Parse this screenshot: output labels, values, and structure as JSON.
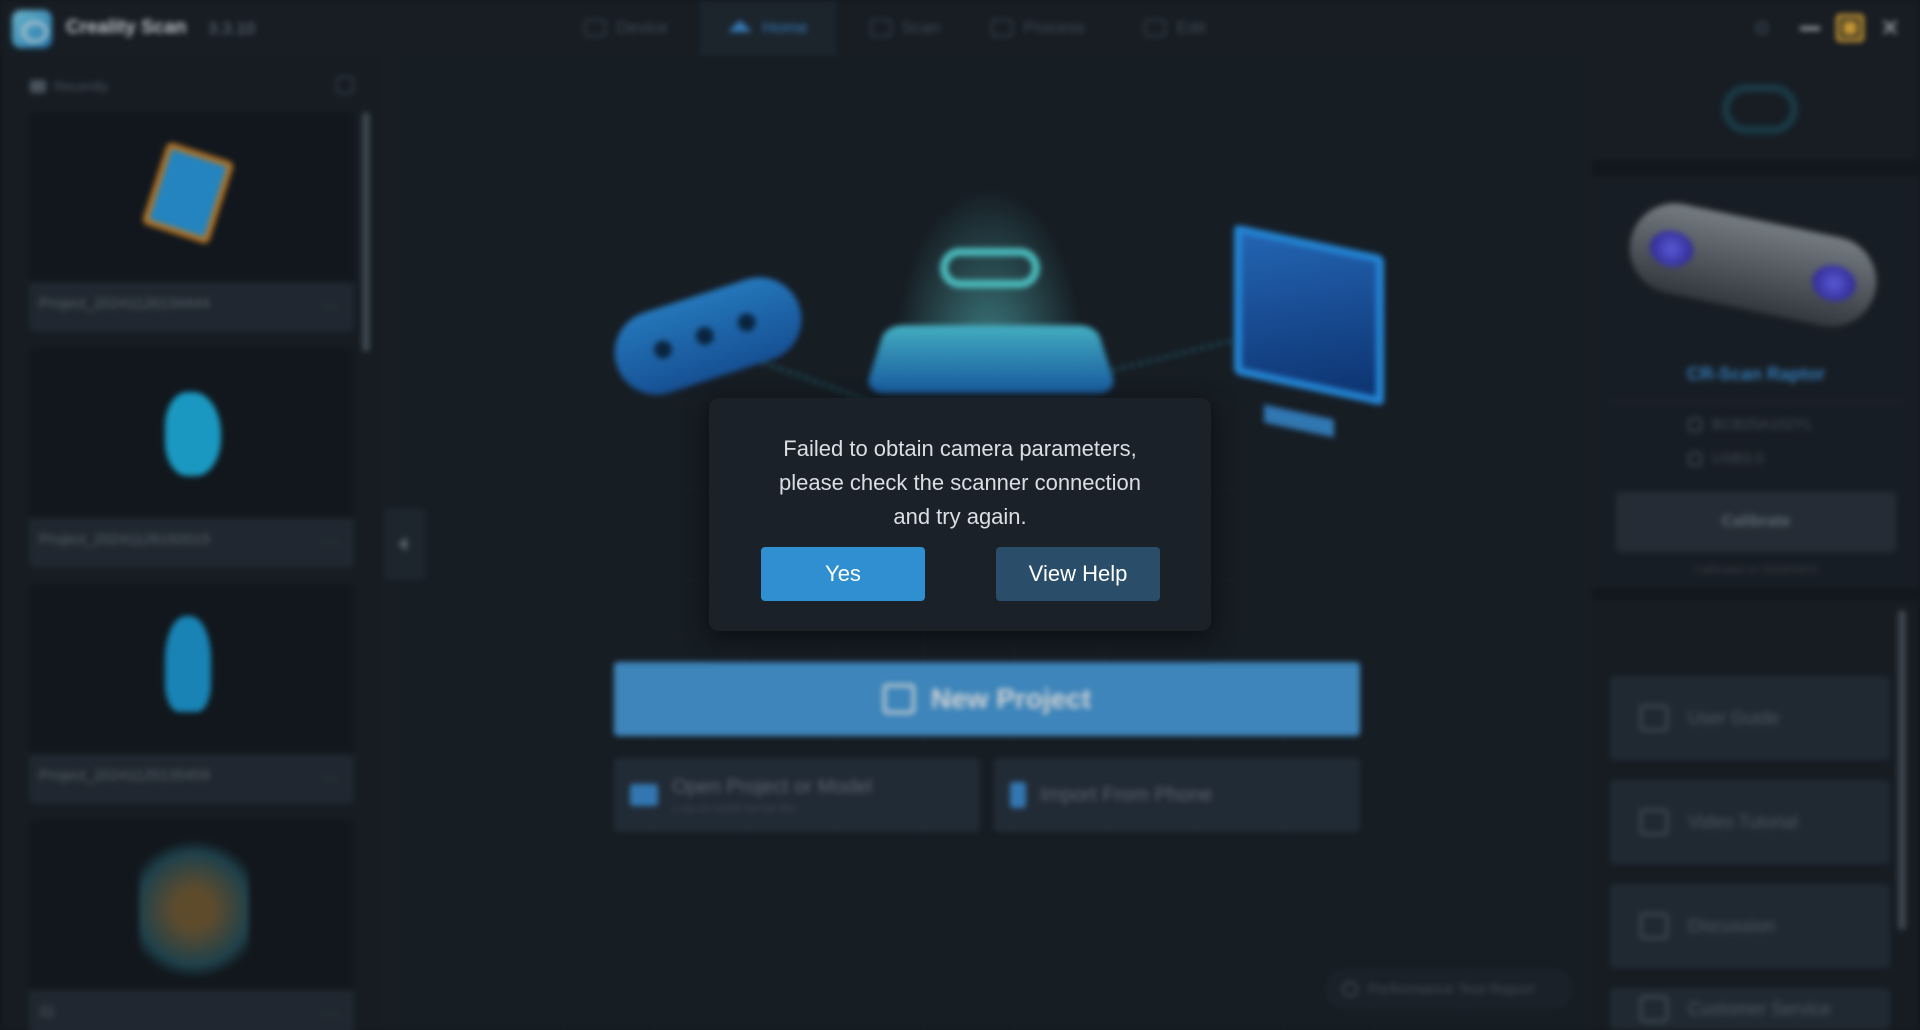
{
  "titlebar": {
    "app_name": "Creality Scan",
    "version": "3.3.10",
    "tabs": [
      {
        "label": "Device",
        "active": false
      },
      {
        "label": "Home",
        "active": true
      },
      {
        "label": "Scan",
        "active": false
      },
      {
        "label": "Process",
        "active": false
      },
      {
        "label": "Edit",
        "active": false
      }
    ]
  },
  "sidebar": {
    "heading": "Recently",
    "projects": [
      {
        "name": "Project_20241126134444",
        "more": "···"
      },
      {
        "name": "Project_20241126192019",
        "more": "···"
      },
      {
        "name": "Project_20241125135459",
        "more": "···"
      },
      {
        "name": "11",
        "more": "···"
      }
    ]
  },
  "main": {
    "new_project": "New Project",
    "open_project": "Open Project or Model",
    "open_project_sub": "(.cxp or model format file)",
    "import_phone": "Import From Phone",
    "performance_report": "Performance Test Report"
  },
  "device": {
    "name": "CR-Scan Raptor",
    "serial": "BCB25A102YL",
    "connection": "USB3.0",
    "calibrate": "Calibrate",
    "calibrated_on": "Calibrated on 2024/04/03"
  },
  "links": [
    {
      "label": "User Guide",
      "icon": "book-icon"
    },
    {
      "label": "Video Tutorial",
      "icon": "video-icon"
    },
    {
      "label": "Discussion",
      "icon": "chat-icon"
    },
    {
      "label": "Customer Service",
      "icon": "person-icon"
    }
  ],
  "dialog": {
    "message_line1": "Failed to obtain camera parameters,",
    "message_line2": "please check the scanner connection",
    "message_line3": "and try again.",
    "yes": "Yes",
    "view_help": "View Help"
  },
  "colors": {
    "accent": "#2f8fd0",
    "primary_button": "#4aa0e0",
    "highlight_maximize": "#f0b43a"
  }
}
